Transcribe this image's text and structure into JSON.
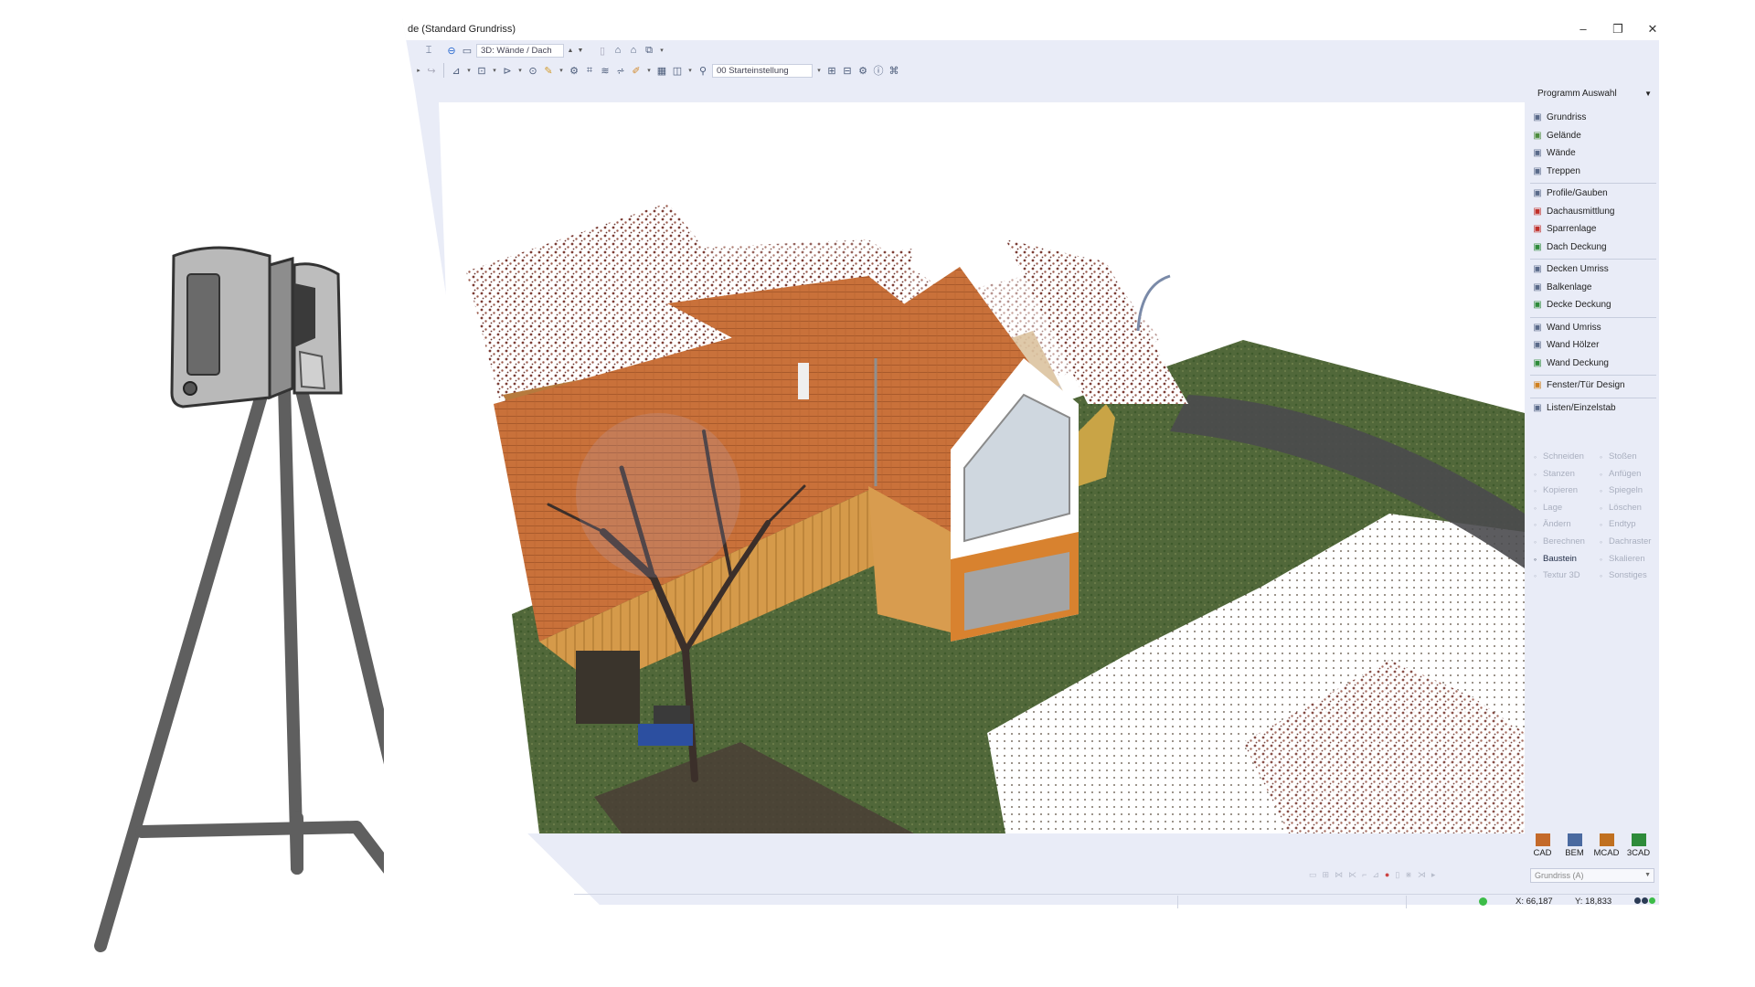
{
  "window": {
    "title": "de (Standard Grundriss)",
    "minimize": "–",
    "maximize": "❐",
    "close": "✕"
  },
  "toolbar": {
    "view_combo": "3D: Wände / Dach",
    "preset_combo": "00 Starteinstellung"
  },
  "program_panel": {
    "select_label": "Programm Auswahl",
    "groups": [
      [
        {
          "label": "Grundriss",
          "icon": "floorplan-icon",
          "color": "#5a6a8a"
        },
        {
          "label": "Gelände",
          "icon": "terrain-icon",
          "color": "#4c8c3c"
        },
        {
          "label": "Wände",
          "icon": "wall-icon",
          "color": "#5a6a8a"
        },
        {
          "label": "Treppen",
          "icon": "stairs-icon",
          "color": "#5a6a8a"
        }
      ],
      [
        {
          "label": "Profile/Gauben",
          "icon": "profile-icon",
          "color": "#5a6a8a"
        },
        {
          "label": "Dachausmittlung",
          "icon": "roof-icon",
          "color": "#c0302a"
        },
        {
          "label": "Sparrenlage",
          "icon": "rafter-icon",
          "color": "#c0302a"
        },
        {
          "label": "Dach Deckung",
          "icon": "roof-cover-icon",
          "color": "#2e8b3a"
        }
      ],
      [
        {
          "label": "Decken Umriss",
          "icon": "ceiling-outline-icon",
          "color": "#5a6a8a"
        },
        {
          "label": "Balkenlage",
          "icon": "beam-icon",
          "color": "#5a6a8a"
        },
        {
          "label": "Decke Deckung",
          "icon": "ceiling-cover-icon",
          "color": "#2e8b3a"
        }
      ],
      [
        {
          "label": "Wand Umriss",
          "icon": "wall-outline-icon",
          "color": "#5a6a8a"
        },
        {
          "label": "Wand Hölzer",
          "icon": "wall-timber-icon",
          "color": "#5a6a8a"
        },
        {
          "label": "Wand Deckung",
          "icon": "wall-cover-icon",
          "color": "#2e8b3a"
        }
      ],
      [
        {
          "label": "Fenster/Tür Design",
          "icon": "window-door-icon",
          "color": "#d0801e"
        }
      ],
      [
        {
          "label": "Listen/Einzelstab",
          "icon": "list-icon",
          "color": "#5a6a8a"
        }
      ]
    ],
    "edit_tools": [
      {
        "left": "Schneiden",
        "left_icon": "scissors-icon",
        "left_active": false,
        "right": "Stoßen",
        "right_icon": "butt-icon",
        "right_active": false
      },
      {
        "left": "Stanzen",
        "left_icon": "punch-icon",
        "left_active": false,
        "right": "Anfügen",
        "right_icon": "append-icon",
        "right_active": false
      },
      {
        "left": "Kopieren",
        "left_icon": "copy-icon",
        "left_active": false,
        "right": "Spiegeln",
        "right_icon": "mirror-icon",
        "right_active": false
      },
      {
        "left": "Lage",
        "left_icon": "position-icon",
        "left_active": false,
        "right": "Löschen",
        "right_icon": "delete-icon",
        "right_active": false
      },
      {
        "left": "Ändern",
        "left_icon": "edit-icon",
        "left_active": false,
        "right": "Endtyp",
        "right_icon": "endtype-icon",
        "right_active": false
      },
      {
        "left": "Berechnen",
        "left_icon": "calculate-icon",
        "left_active": false,
        "right": "Dachraster",
        "right_icon": "roof-grid-icon",
        "right_active": false
      },
      {
        "left": "Baustein",
        "left_icon": "component-icon",
        "left_active": true,
        "right": "Skalieren",
        "right_icon": "scale-icon",
        "right_active": false
      },
      {
        "left": "Textur 3D",
        "left_icon": "texture-icon",
        "left_active": false,
        "right": "Sonstiges",
        "right_icon": "misc-icon",
        "right_active": false
      }
    ],
    "modes": [
      {
        "label": "CAD",
        "icon": "cad-icon",
        "color": "#c46a2a"
      },
      {
        "label": "BEM",
        "icon": "bem-icon",
        "color": "#4a6aa0"
      },
      {
        "label": "MCAD",
        "icon": "mcad-icon",
        "color": "#c07020"
      },
      {
        "label": "3CAD",
        "icon": "3cad-icon",
        "color": "#2e8b3a"
      }
    ],
    "plan_select": "Grundriss (A)"
  },
  "statusbar": {
    "x": "X: 66,187",
    "y": "Y: 18,833"
  }
}
